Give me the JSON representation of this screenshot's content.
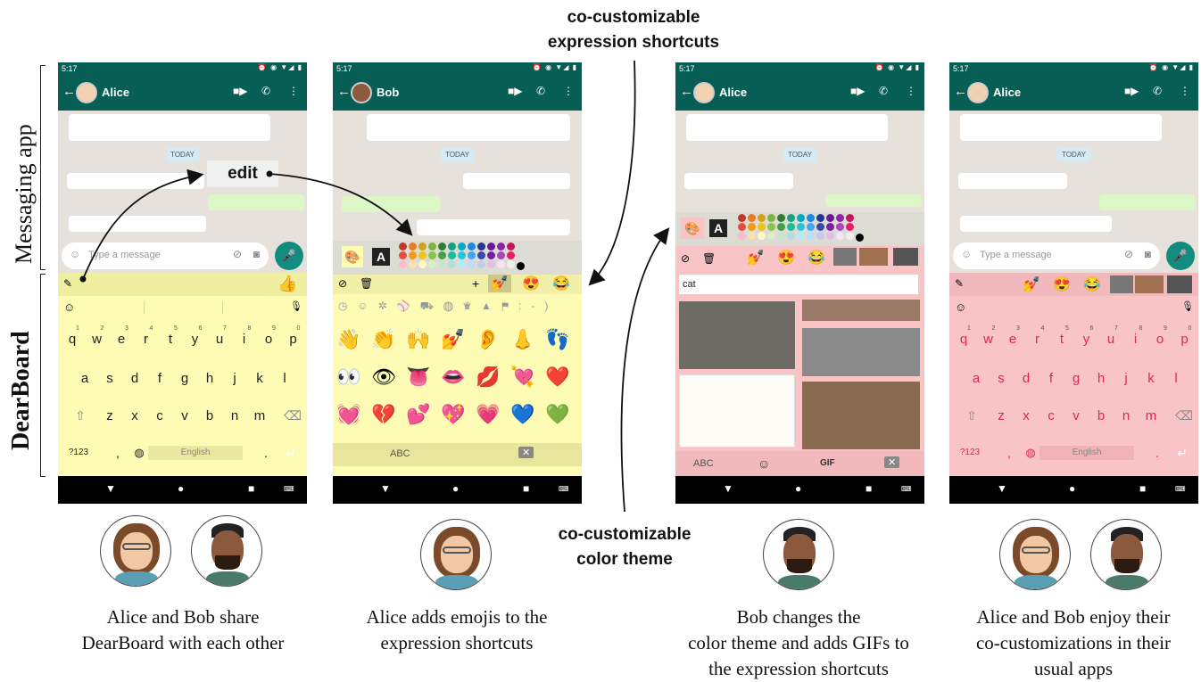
{
  "top_label": [
    "co-customizable",
    "expression shortcuts"
  ],
  "middle_label": [
    "co-customizable",
    "color theme"
  ],
  "edit_label": "edit",
  "side_labels": {
    "messaging": "Messaging app",
    "keyboard": "DearBoard"
  },
  "status_time": "5:17",
  "phones": [
    {
      "contact": "Alice",
      "today": "TODAY",
      "placeholder": "Type a message"
    },
    {
      "contact": "Bob",
      "today": "TODAY"
    },
    {
      "contact": "Alice",
      "today": "TODAY",
      "search": "cat"
    },
    {
      "contact": "Alice",
      "today": "TODAY",
      "placeholder": "Type a message"
    }
  ],
  "keyboard": {
    "row1": [
      "q",
      "w",
      "e",
      "r",
      "t",
      "y",
      "u",
      "i",
      "o",
      "p"
    ],
    "row1_nums": [
      "1",
      "2",
      "3",
      "4",
      "5",
      "6",
      "7",
      "8",
      "9",
      "0"
    ],
    "row2": [
      "a",
      "s",
      "d",
      "f",
      "g",
      "h",
      "j",
      "k",
      "l"
    ],
    "row3": [
      "z",
      "x",
      "c",
      "v",
      "b",
      "n",
      "m"
    ],
    "sym": "?123",
    "comma": ",",
    "period": ".",
    "space": "English",
    "abc": "ABC",
    "gif": "GIF",
    "theme_a": "A"
  },
  "emoji_rows": [
    [
      "👋",
      "👏",
      "🙌",
      "💅",
      "👂",
      "👃",
      "👣"
    ],
    [
      "👀",
      "👁",
      "👅",
      "👄",
      "💋",
      "💘",
      "❤️"
    ],
    [
      "💓",
      "💔",
      "💕",
      "💖",
      "💗",
      "💙",
      "💚"
    ]
  ],
  "shortcut_emojis": [
    "💅",
    "😍",
    "😂"
  ],
  "thumbs": "👍",
  "captions": [
    [
      "Alice and Bob share",
      "DearBoard with each other"
    ],
    [
      "Alice adds emojis to the",
      "expression shortcuts"
    ],
    [
      "Bob changes the",
      "color theme and adds GIFs to",
      "the expression shortcuts"
    ],
    [
      "Alice and Bob enjoy their",
      "co-customizations in their",
      "usual apps"
    ]
  ],
  "colors": {
    "whatsapp_green": "#075e54",
    "yellow_theme": "#fdfbb4",
    "pink_theme": "#f9c4c6",
    "key_pink": "#e0245e"
  }
}
